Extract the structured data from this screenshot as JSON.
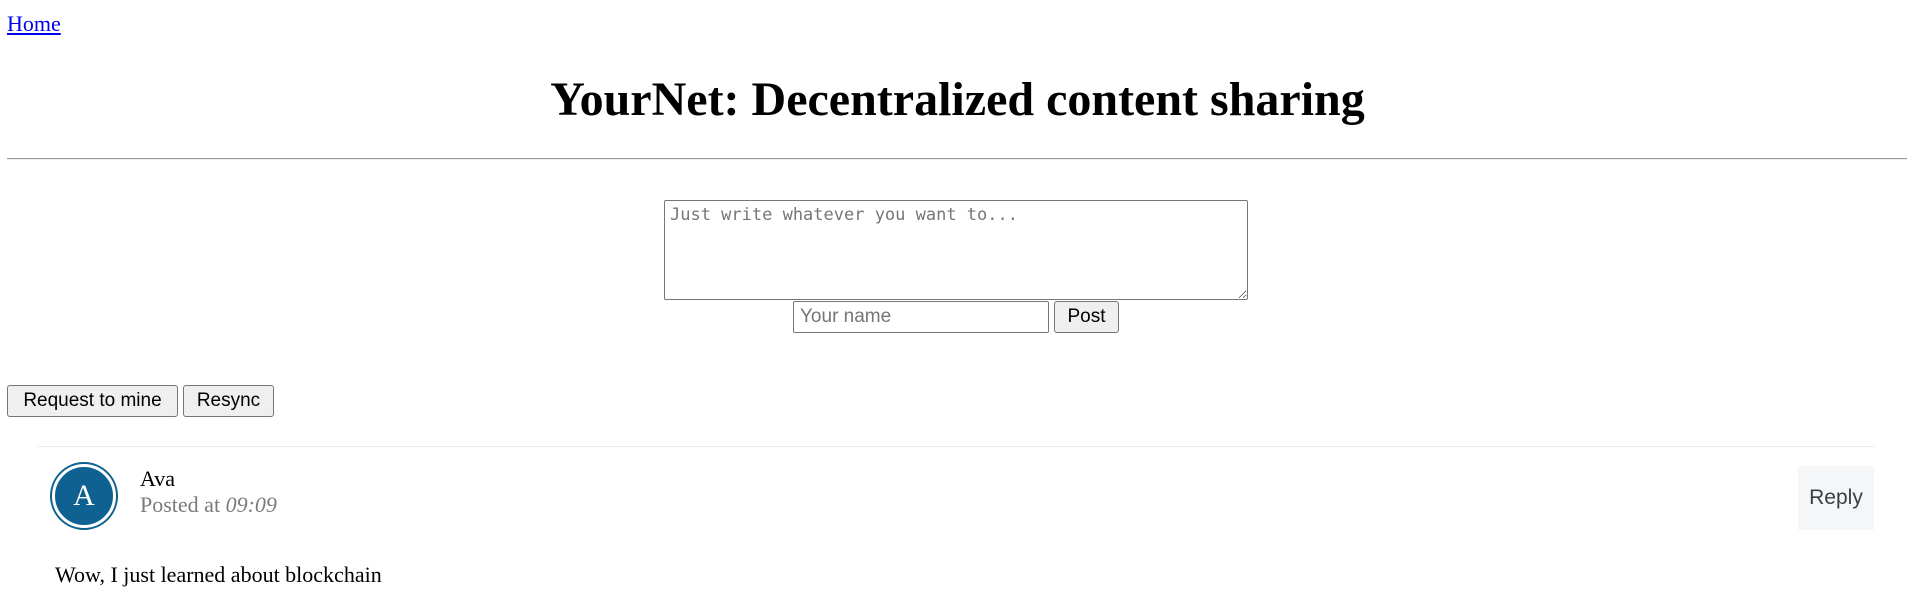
{
  "nav": {
    "home_label": "Home"
  },
  "header": {
    "title": "YourNet: Decentralized content sharing"
  },
  "composer": {
    "content_placeholder": "Just write whatever you want to...",
    "name_placeholder": "Your name",
    "post_label": "Post"
  },
  "actions": {
    "mine_label": "Request to mine",
    "resync_label": "Resync"
  },
  "feed": {
    "posts": [
      {
        "avatar_letter": "A",
        "author": "Ava",
        "posted_prefix": "Posted at",
        "time": "09:09",
        "reply_label": "Reply",
        "body": "Wow, I just learned about blockchain"
      }
    ]
  },
  "colors": {
    "avatar_bg": "#0e6191",
    "link": "#0000ee",
    "muted_text": "#7a7a7a",
    "reply_bg": "#f5f6f7"
  }
}
